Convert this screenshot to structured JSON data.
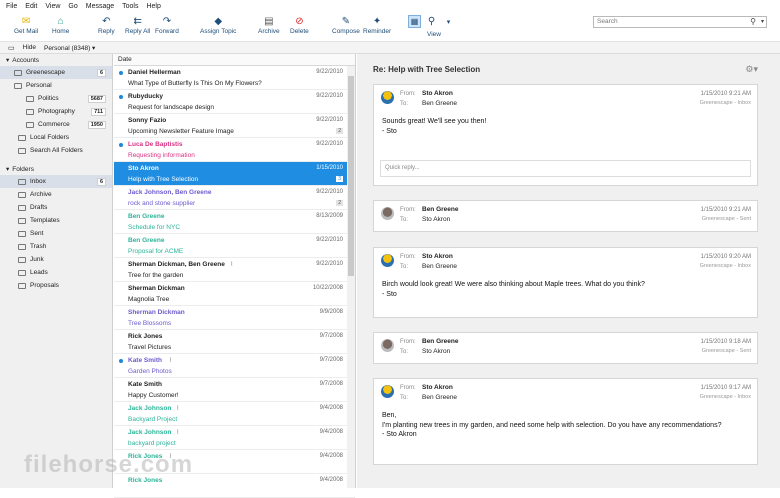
{
  "menu": [
    "File",
    "Edit",
    "View",
    "Go",
    "Message",
    "Tools",
    "Help"
  ],
  "toolbar": {
    "get_mail": "Get Mail",
    "home": "Home",
    "reply": "Reply",
    "reply_all": "Reply All",
    "forward": "Forward",
    "assign_topic": "Assign Topic",
    "archive": "Archive",
    "delete": "Delete",
    "compose": "Compose",
    "reminder": "Reminder",
    "view": "View",
    "search_placeholder": "Search"
  },
  "subbar": {
    "hide": "Hide",
    "account": "Personal (8348)"
  },
  "sidebar": {
    "accounts_header": "Accounts",
    "accounts": [
      {
        "label": "Greenescape",
        "badge": "6"
      },
      {
        "label": "Personal",
        "badge": ""
      },
      {
        "label": "Politics",
        "badge": "5687"
      },
      {
        "label": "Photography",
        "badge": "711"
      },
      {
        "label": "Commerce",
        "badge": "1950"
      },
      {
        "label": "Local Folders",
        "badge": ""
      },
      {
        "label": "Search All Folders",
        "badge": ""
      }
    ],
    "folders_header": "Folders",
    "folders": [
      {
        "label": "Inbox",
        "badge": "6"
      },
      {
        "label": "Archive"
      },
      {
        "label": "Drafts"
      },
      {
        "label": "Templates"
      },
      {
        "label": "Sent"
      },
      {
        "label": "Trash"
      },
      {
        "label": "Junk"
      },
      {
        "label": "Leads"
      },
      {
        "label": "Proposals"
      }
    ]
  },
  "messages_header": "Date",
  "messages": [
    {
      "sender": "Daniel Hellerman",
      "subject": "What Type of Butterfly Is This On My Flowers?",
      "date": "9/22/2010",
      "count": "",
      "unread": true
    },
    {
      "sender": "Rubyducky",
      "subject": "Request for landscape design",
      "date": "9/22/2010",
      "count": "",
      "unread": true
    },
    {
      "sender": "Sonny Fazio",
      "subject": "Upcoming Newsletter Feature Image",
      "date": "9/22/2010",
      "count": "2",
      "unread": false
    },
    {
      "sender": "Luca De Baptistis",
      "subject": "Requesting information",
      "date": "9/22/2010",
      "count": "",
      "unread": true
    },
    {
      "sender": "Sto Akron",
      "subject": "Help with Tree Selection",
      "date": "1/15/2010",
      "count": "3",
      "unread": false
    },
    {
      "sender": "Jack Johnson, Ben Greene",
      "subject": "rock and stone supplier",
      "date": "9/22/2010",
      "count": "2",
      "unread": false
    },
    {
      "sender": "Ben Greene",
      "subject": "Schedule for NYC",
      "date": "8/13/2009",
      "count": "",
      "unread": false
    },
    {
      "sender": "Ben Greene",
      "subject": "Proposal for ACME",
      "date": "9/22/2010",
      "count": "",
      "unread": false
    },
    {
      "sender": "Sherman Dickman, Ben Greene",
      "subject": "Tree for the garden",
      "date": "9/22/2010",
      "count": "",
      "unread": false
    },
    {
      "sender": "Sherman Dickman",
      "subject": "Magnolia Tree",
      "date": "10/22/2008",
      "count": "",
      "unread": false
    },
    {
      "sender": "Sherman Dickman",
      "subject": "Tree Blossoms",
      "date": "9/9/2008",
      "count": "",
      "unread": false
    },
    {
      "sender": "Rick Jones",
      "subject": "Travel Pictures",
      "date": "9/7/2008",
      "count": "",
      "unread": false
    },
    {
      "sender": "Kate Smith",
      "subject": "Garden Photos",
      "date": "9/7/2008",
      "count": "",
      "unread": true
    },
    {
      "sender": "Kate Smith",
      "subject": "Happy Customer!",
      "date": "9/7/2008",
      "count": "",
      "unread": false
    },
    {
      "sender": "Jack Johnson",
      "subject": "Backyard Project",
      "date": "9/4/2008",
      "count": "",
      "unread": false
    },
    {
      "sender": "Jack Johnson",
      "subject": "backyard project",
      "date": "9/4/2008",
      "count": "",
      "unread": false
    },
    {
      "sender": "Rick Jones",
      "subject": "",
      "date": "9/4/2008",
      "count": "",
      "unread": false
    },
    {
      "sender": "Rick Jones",
      "subject": "",
      "date": "9/4/2008",
      "count": "",
      "unread": false
    }
  ],
  "reading": {
    "title": "Re: Help with Tree Selection",
    "cards": [
      {
        "from": "Sto Akron",
        "to": "Ben Greene",
        "time": "1/15/2010 9:21 AM",
        "account": "Greenescape - Inbox",
        "body": [
          "Sounds great!  We'll see you then!",
          "- Sto"
        ],
        "quick_reply": "Quick reply..."
      },
      {
        "from": "Ben Greene",
        "to": "Sto Akron",
        "time": "1/15/2010 9:21 AM",
        "account": "Greenescape - Sent",
        "body": []
      },
      {
        "from": "Sto Akron",
        "to": "Ben Greene",
        "time": "1/15/2010 9:20 AM",
        "account": "Greenescape - Inbox",
        "body": [
          "Birch would look great!  We were also thinking about Maple trees.  What do you think?",
          "- Sto"
        ]
      },
      {
        "from": "Ben Greene",
        "to": "Sto Akron",
        "time": "1/15/2010 9:18 AM",
        "account": "Greenescape - Sent",
        "body": []
      },
      {
        "from": "Sto Akron",
        "to": "Ben Greene",
        "time": "1/15/2010 9:17 AM",
        "account": "Greenescape - Inbox",
        "body": [
          "Ben,",
          "I'm planting new trees in my garden, and need some help with selection.  Do you have any recommendations?",
          "- Sto Akron"
        ]
      }
    ],
    "from_label": "From:",
    "to_label": "To:"
  },
  "watermark": "filehorse.com",
  "colors": {
    "accent": "#1e8de2",
    "teal": "#2bb39a",
    "purple": "#6a5bcc",
    "pink": "#d63384"
  }
}
